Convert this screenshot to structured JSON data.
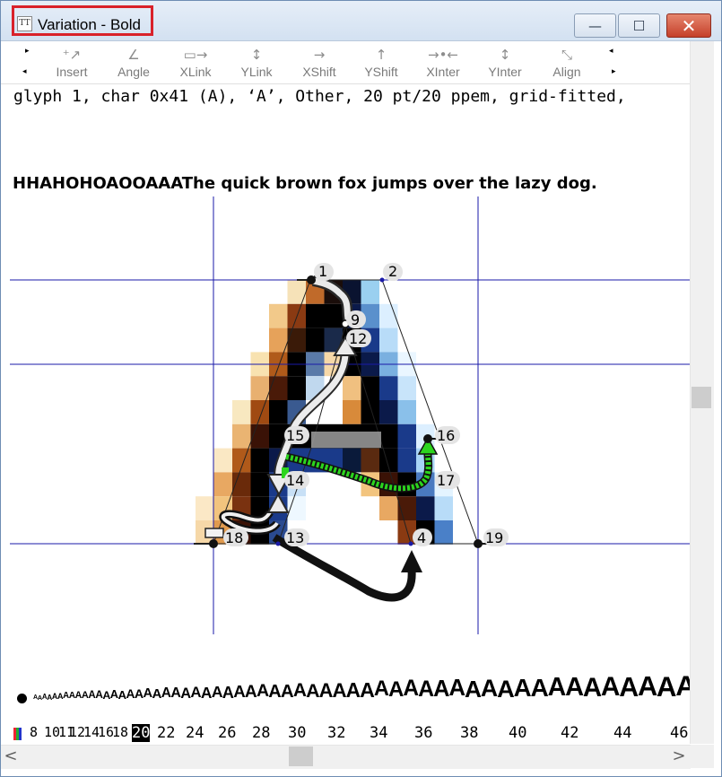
{
  "window": {
    "title": "Variation - Bold",
    "minimize_glyph": "—",
    "maximize_glyph": "☐",
    "close_glyph": "✕"
  },
  "toolbar": {
    "tools": [
      {
        "label": "Insert",
        "icon": "insert-icon",
        "glyph": "⁺↗"
      },
      {
        "label": "Angle",
        "icon": "angle-icon",
        "glyph": "∠"
      },
      {
        "label": "XLink",
        "icon": "xlink-icon",
        "glyph": "▭→"
      },
      {
        "label": "YLink",
        "icon": "ylink-icon",
        "glyph": "↕"
      },
      {
        "label": "XShift",
        "icon": "xshift-icon",
        "glyph": "→"
      },
      {
        "label": "YShift",
        "icon": "yshift-icon",
        "glyph": "↑"
      },
      {
        "label": "XInter",
        "icon": "xinter-icon",
        "glyph": "→•←"
      },
      {
        "label": "YInter",
        "icon": "yinter-icon",
        "glyph": "↕"
      },
      {
        "label": "Align",
        "icon": "align-icon",
        "glyph": "⤡"
      }
    ]
  },
  "info_line": "glyph 1, char 0x41 (A), ‘A’, Other, 20 pt/20 ppem, grid-fitted,",
  "sample_text": "HHAHOHOAOOAAAThe quick brown fox jumps over the lazy dog.",
  "glyph_view": {
    "points": [
      {
        "id": "p1",
        "label": "1"
      },
      {
        "id": "p2",
        "label": "2"
      },
      {
        "id": "p9",
        "label": "9"
      },
      {
        "id": "p12",
        "label": "12"
      },
      {
        "id": "p15",
        "label": "15"
      },
      {
        "id": "p16",
        "label": "16"
      },
      {
        "id": "p14",
        "label": "14"
      },
      {
        "id": "p17",
        "label": "17"
      },
      {
        "id": "p18",
        "label": "18"
      },
      {
        "id": "p13",
        "label": "13"
      },
      {
        "id": "p4",
        "label": "4"
      },
      {
        "id": "p19",
        "label": "19"
      }
    ],
    "colors": {
      "gridline": "#1a1aa8",
      "move_arrow": "#2cd61e",
      "link_arrow": "#111111",
      "shift_arrow": "#ebebeb"
    }
  },
  "waterfall": {
    "char": "A"
  },
  "sizes": {
    "items": [
      "8",
      "10",
      "11",
      "12",
      "14",
      "16",
      "18",
      "20",
      "22",
      "24",
      "26",
      "28",
      "30",
      "32",
      "34",
      "36",
      "38",
      "40",
      "42",
      "44",
      "46"
    ],
    "selected": "20"
  },
  "scroll": {
    "left_arrow": "<",
    "right_arrow": ">"
  }
}
